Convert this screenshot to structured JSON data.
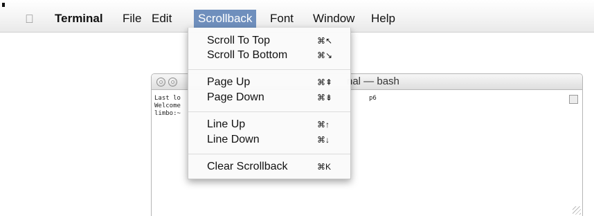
{
  "menubar": {
    "app_name": "Terminal",
    "menus": [
      "File",
      "Edit",
      "Scrollback",
      "Font",
      "Window",
      "Help"
    ],
    "active_menu": "Scrollback"
  },
  "window": {
    "title": "Terminal — bash",
    "title_visible": "nal — bash",
    "lines": [
      "Last lo",
      "Welcome",
      "limbo:~"
    ],
    "line_suffix": "p6"
  },
  "scrollback_menu": {
    "groups": [
      [
        {
          "label": "Scroll To Top",
          "shortcut": "⌘↖"
        },
        {
          "label": "Scroll To Bottom",
          "shortcut": "⌘↘"
        }
      ],
      [
        {
          "label": "Page Up",
          "shortcut": "⌘⇞"
        },
        {
          "label": "Page Down",
          "shortcut": "⌘⇟"
        }
      ],
      [
        {
          "label": "Line Up",
          "shortcut": "⌘↑"
        },
        {
          "label": "Line Down",
          "shortcut": "⌘↓"
        }
      ],
      [
        {
          "label": "Clear Scrollback",
          "shortcut": "⌘K"
        }
      ]
    ]
  }
}
